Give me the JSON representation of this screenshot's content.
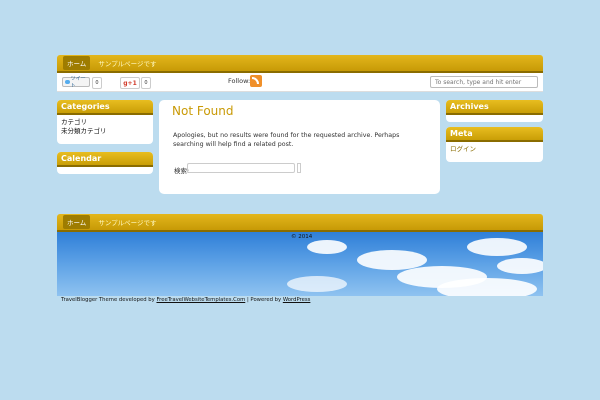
{
  "nav": {
    "items": [
      {
        "label": "ホーム"
      },
      {
        "label": "サンプルページです"
      }
    ]
  },
  "sharebar": {
    "tweet_label": "ツイート",
    "tweet_count": "0",
    "gplus_label": "g+1",
    "gplus_count": "0",
    "follow_label": "Follow:",
    "search_placeholder": "To search, type and hit enter"
  },
  "left_sidebar": {
    "categories_title": "Categories",
    "categories": [
      "カテゴリ",
      "未分類カテゴリ"
    ],
    "calendar_title": "Calendar"
  },
  "main": {
    "title": "Not Found",
    "message": "Apologies, but no results were found for the requested archive. Perhaps searching will help find a related post.",
    "search_label": "検索:"
  },
  "right_sidebar": {
    "archives_title": "Archives",
    "meta_title": "Meta",
    "meta_items": [
      "ログイン"
    ]
  },
  "footer": {
    "nav_items": [
      {
        "label": "ホーム"
      },
      {
        "label": "サンプルページです"
      }
    ],
    "copyright": "© 2014",
    "credit_prefix": "TravelBlogger Theme developed by ",
    "credit_link1": "FreeTravelWebsiteTemplates.Com",
    "credit_mid": " | Powered by ",
    "credit_link2": "WordPress"
  },
  "colors": {
    "background": "#bcdcef",
    "accent_gold": "#c99a06",
    "nav_active": "#9e7c00"
  }
}
